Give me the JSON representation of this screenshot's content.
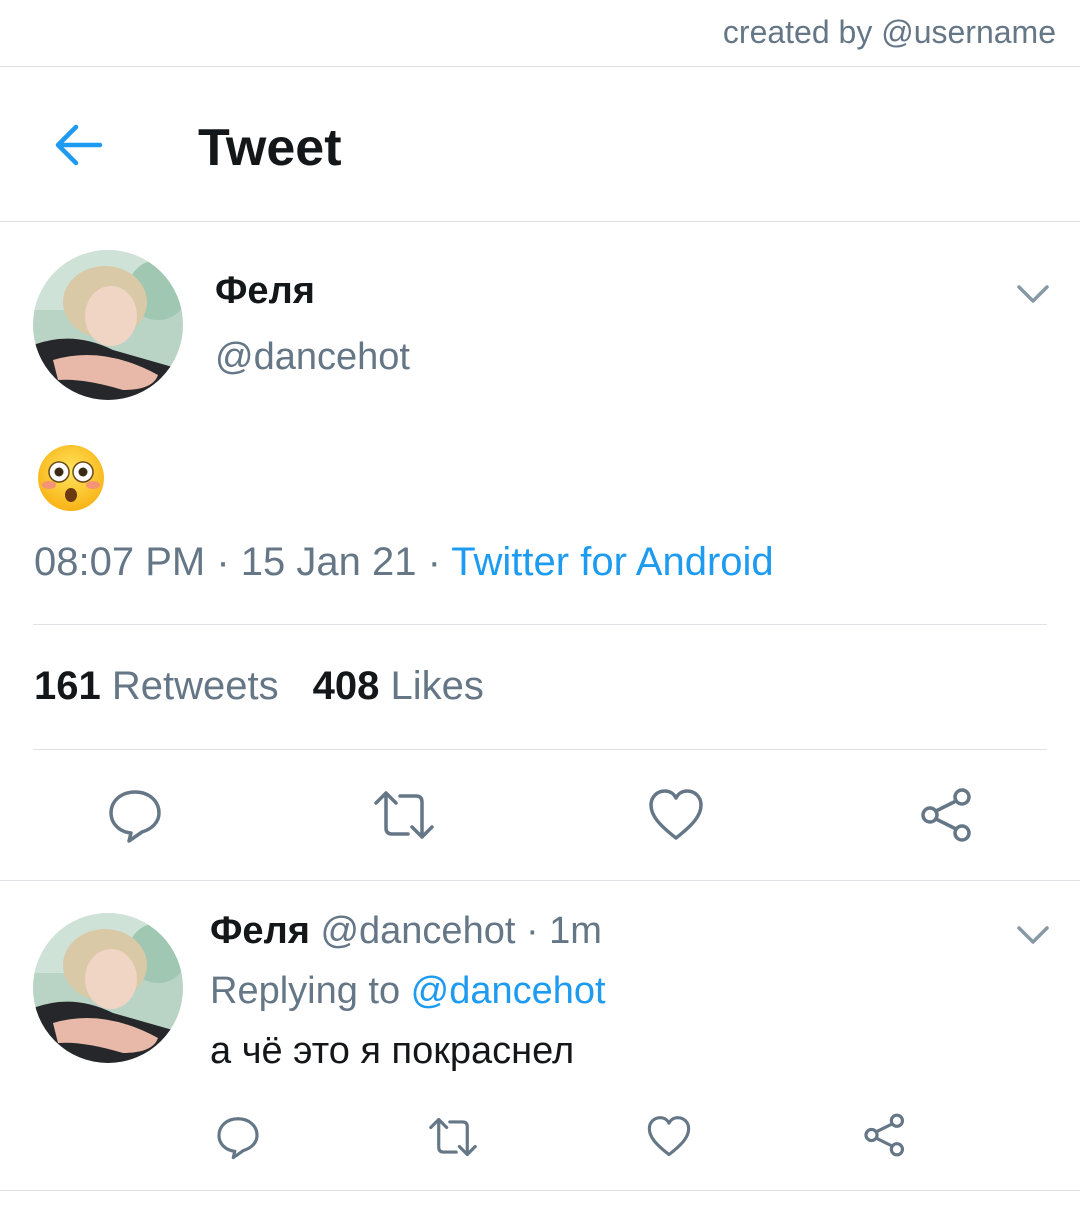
{
  "credit": "created by @username",
  "header": {
    "title": "Tweet",
    "back_icon": "arrow-left-icon"
  },
  "tweet": {
    "name": "Феля",
    "handle": "@dancehot",
    "emoji": "flushed-face",
    "time": "08:07 PM",
    "sep1": " · ",
    "date": "15 Jan 21",
    "sep2": " · ",
    "source": "Twitter for Android",
    "retweets_count": "161",
    "retweets_label": "Retweets",
    "likes_count": "408",
    "likes_label": "Likes",
    "actions": [
      "reply-icon",
      "retweet-icon",
      "like-icon",
      "share-icon"
    ]
  },
  "reply": {
    "name": "Феля",
    "handle": "@dancehot",
    "dot": " · ",
    "time": "1m",
    "replying_prefix": "Replying to ",
    "replying_handle": "@dancehot",
    "text": "а чё это я покраснел"
  },
  "colors": {
    "accent": "#1d9bf0",
    "muted": "#657786",
    "text": "#14171a",
    "divider": "#dfe3e6"
  }
}
